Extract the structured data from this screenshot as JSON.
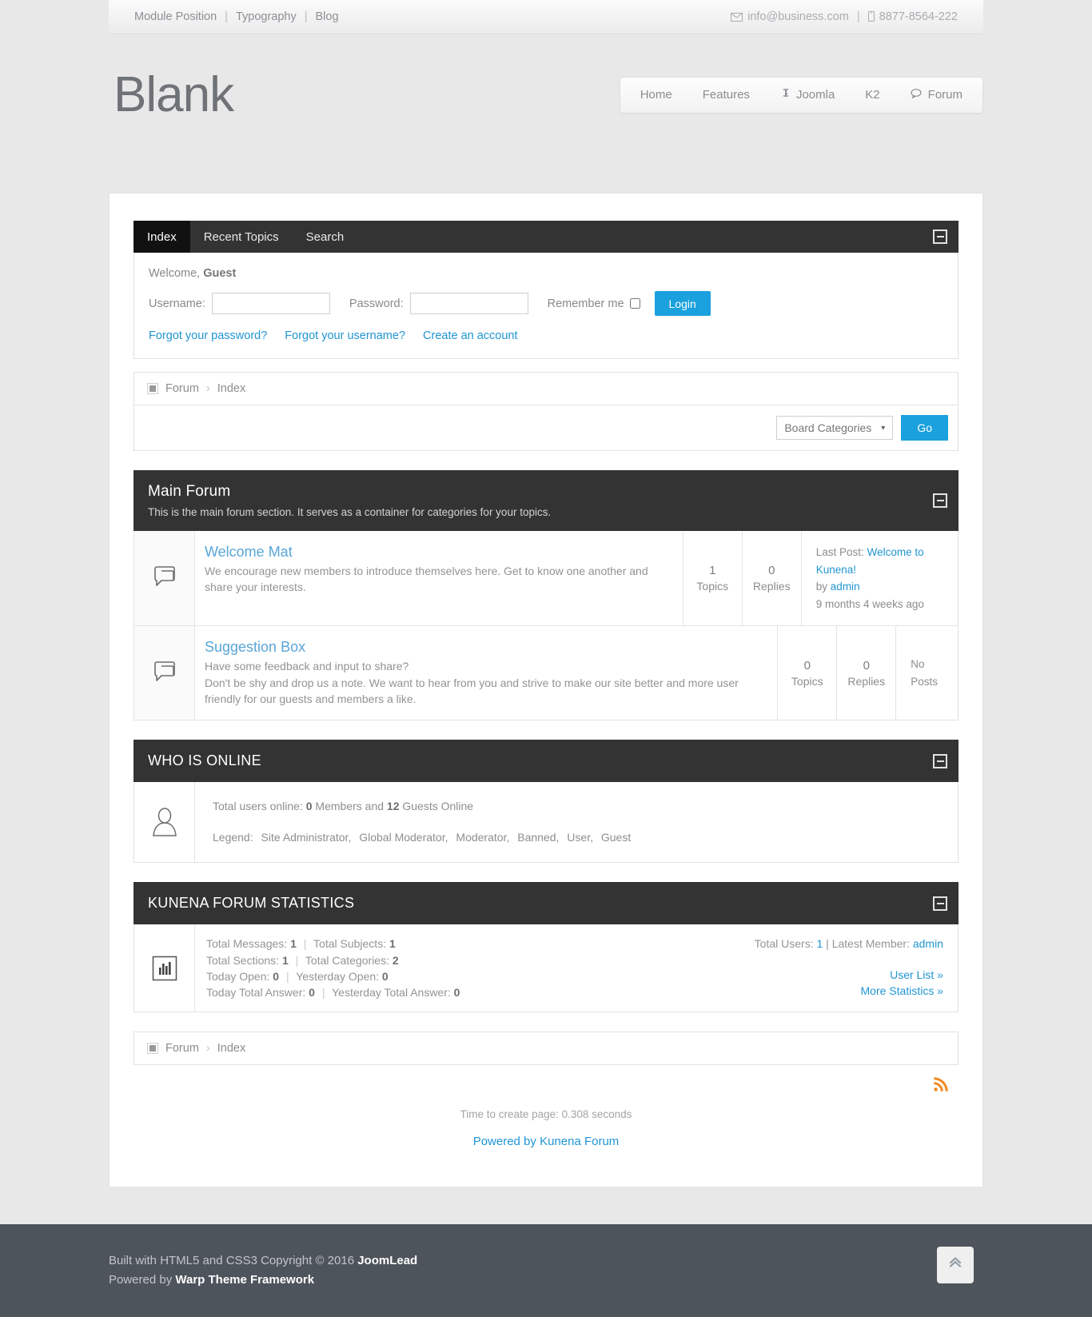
{
  "topbar": {
    "links": [
      {
        "label": "Module Position"
      },
      {
        "label": "Typography"
      },
      {
        "label": "Blog"
      }
    ],
    "separator": "|",
    "email": "info@business.com",
    "phone": "8877-8564-222",
    "email_icon": "mail-icon",
    "phone_icon": "phone-icon"
  },
  "header": {
    "logo": "Blank",
    "nav": [
      {
        "label": "Home",
        "icon": null
      },
      {
        "label": "Features",
        "icon": null
      },
      {
        "label": "Joomla",
        "icon": "joomla-icon"
      },
      {
        "label": "K2",
        "icon": null
      },
      {
        "label": "Forum",
        "icon": "comment-icon"
      }
    ]
  },
  "forum": {
    "tabs": [
      {
        "label": "Index",
        "active": true
      },
      {
        "label": "Recent Topics",
        "active": false
      },
      {
        "label": "Search",
        "active": false
      }
    ],
    "login": {
      "welcome_prefix": "Welcome,",
      "welcome_user": "Guest",
      "username_label": "Username:",
      "username_value": "",
      "password_label": "Password:",
      "password_value": "",
      "remember_label": "Remember me",
      "login_button": "Login",
      "links": [
        {
          "label": "Forgot your password?"
        },
        {
          "label": "Forgot your username?"
        },
        {
          "label": "Create an account"
        }
      ]
    },
    "breadcrumb": {
      "root": "Forum",
      "arrow": "›",
      "current": "Index"
    },
    "toolbar": {
      "select_value": "Board Categories",
      "caret": "▾",
      "go_button": "Go"
    },
    "main_section": {
      "title": "Main Forum",
      "description": "This is the main forum section. It serves as a container for categories for your topics.",
      "categories": [
        {
          "icon": "forum-category-icon",
          "title": "Welcome Mat",
          "description": "We encourage new members to introduce themselves here. Get to know one another and share your interests.",
          "topics_count": "1",
          "topics_label": "Topics",
          "replies_count": "0",
          "replies_label": "Replies",
          "last_post_prefix": "Last Post:",
          "last_post_title": "Welcome to Kunena!",
          "last_post_by_prefix": "by",
          "last_post_author": "admin",
          "last_post_time": "9 months 4 weeks ago",
          "no_posts": null
        },
        {
          "icon": "forum-category-icon",
          "title": "Suggestion Box",
          "description": "Have some feedback and input to share?\nDon't be shy and drop us a note. We want to hear from you and strive to make our site better and more user friendly for our guests and members a like.",
          "topics_count": "0",
          "topics_label": "Topics",
          "replies_count": "0",
          "replies_label": "Replies",
          "last_post_prefix": null,
          "last_post_title": null,
          "last_post_by_prefix": null,
          "last_post_author": null,
          "last_post_time": null,
          "no_posts": "No Posts"
        }
      ]
    },
    "who_is_online": {
      "title": "WHO IS ONLINE",
      "icon": "user-icon",
      "total_prefix": "Total users online:",
      "members_count": "0",
      "members_label": "Members and",
      "guests_count": "12",
      "guests_label": "Guests Online",
      "legend_label": "Legend:",
      "legend_items": [
        "Site Administrator,",
        "Global Moderator,",
        "Moderator,",
        "Banned,",
        "User,",
        "Guest"
      ]
    },
    "statistics": {
      "title": "KUNENA FORUM STATISTICS",
      "icon": "bar-chart-icon",
      "left_rows": [
        {
          "label1": "Total Messages:",
          "value1": "1",
          "sep": "|",
          "label2": "Total Subjects:",
          "value2": "1"
        },
        {
          "label1": "Total Sections:",
          "value1": "1",
          "sep": "|",
          "label2": "Total Categories:",
          "value2": "2"
        },
        {
          "label1": "Today Open:",
          "value1": "0",
          "sep": "|",
          "label2": "Yesterday Open:",
          "value2": "0"
        },
        {
          "label1": "Today Total Answer:",
          "value1": "0",
          "sep": "|",
          "label2": "Yesterday Total Answer:",
          "value2": "0"
        }
      ],
      "total_users_label": "Total Users:",
      "total_users_value": "1",
      "sep": "|",
      "latest_member_label": "Latest Member:",
      "latest_member_value": "admin",
      "user_list_link": "User List »",
      "more_statistics_link": "More Statistics »"
    },
    "footer": {
      "rss_icon": "rss-icon",
      "time_text": "Time to create page: 0.308 seconds",
      "powered_link": "Powered by Kunena Forum"
    }
  },
  "page_footer": {
    "line1_prefix": "Built with HTML5 and CSS3 Copyright © 2016",
    "line1_brand": "JoomLead",
    "line2_prefix": "Powered by",
    "line2_brand": "Warp Theme Framework",
    "to_top_icon": "chevron-double-up-icon"
  },
  "colors": {
    "accent": "#1ba1dd",
    "link": "#2196d3",
    "dark_header": "#333333",
    "tab_active": "#111111",
    "footer_bg": "#4e545c",
    "rss_orange": "#f08a22"
  }
}
